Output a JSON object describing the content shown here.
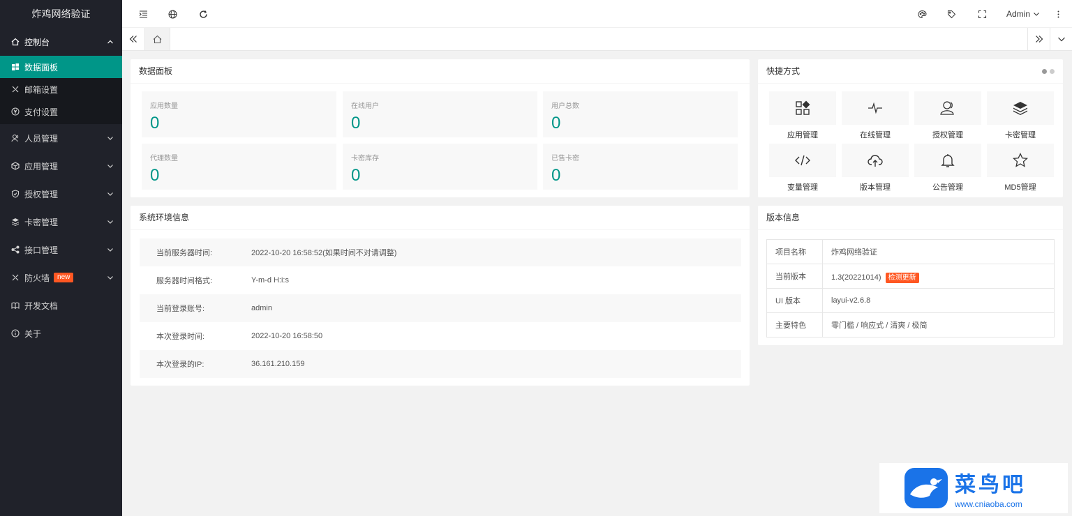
{
  "app": {
    "title": "炸鸡网络验证"
  },
  "sidebar": {
    "console": {
      "label": "控制台"
    },
    "console_items": [
      {
        "label": "数据面板",
        "icon": "grid-icon",
        "active": true
      },
      {
        "label": "邮箱设置",
        "icon": "tool-icon"
      },
      {
        "label": "支付设置",
        "icon": "yen-icon"
      }
    ],
    "items": [
      {
        "label": "人员管理",
        "icon": "users-icon"
      },
      {
        "label": "应用管理",
        "icon": "cube-icon"
      },
      {
        "label": "授权管理",
        "icon": "shield-icon"
      },
      {
        "label": "卡密管理",
        "icon": "layers-icon"
      },
      {
        "label": "接口管理",
        "icon": "share-icon"
      },
      {
        "label": "防火墙",
        "icon": "tool-icon",
        "badge": "new"
      },
      {
        "label": "开发文档",
        "icon": "docs-icon"
      },
      {
        "label": "关于",
        "icon": "info-icon"
      }
    ]
  },
  "header": {
    "user": "Admin"
  },
  "stats": {
    "title": "数据面板",
    "items": [
      {
        "label": "应用数量",
        "value": "0"
      },
      {
        "label": "在线用户",
        "value": "0"
      },
      {
        "label": "用户总数",
        "value": "0"
      },
      {
        "label": "代理数量",
        "value": "0"
      },
      {
        "label": "卡密库存",
        "value": "0"
      },
      {
        "label": "已售卡密",
        "value": "0"
      }
    ]
  },
  "shortcuts": {
    "title": "快捷方式",
    "items": [
      {
        "label": "应用管理",
        "icon": "apps-icon"
      },
      {
        "label": "在线管理",
        "icon": "pulse-icon"
      },
      {
        "label": "授权管理",
        "icon": "user-icon"
      },
      {
        "label": "卡密管理",
        "icon": "layers-icon"
      },
      {
        "label": "变量管理",
        "icon": "code-icon"
      },
      {
        "label": "版本管理",
        "icon": "cloud-upload-icon"
      },
      {
        "label": "公告管理",
        "icon": "bell-icon"
      },
      {
        "label": "MD5管理",
        "icon": "star-icon"
      }
    ]
  },
  "system": {
    "title": "系统环境信息",
    "rows": [
      {
        "key": "当前服务器时间:",
        "value": "2022-10-20 16:58:52(如果时间不对请调整)"
      },
      {
        "key": "服务器时间格式:",
        "value": "Y-m-d H:i:s"
      },
      {
        "key": "当前登录账号:",
        "value": "admin"
      },
      {
        "key": "本次登录时间:",
        "value": "2022-10-20 16:58:50"
      },
      {
        "key": "本次登录的IP:",
        "value": "36.161.210.159"
      }
    ]
  },
  "version": {
    "title": "版本信息",
    "rows": [
      {
        "key": "项目名称",
        "value": "炸鸡网络验证"
      },
      {
        "key": "当前版本",
        "value": "1.3(20221014)",
        "tag": "检测更新"
      },
      {
        "key": "UI 版本",
        "value": "layui-v2.6.8"
      },
      {
        "key": "主要特色",
        "value": "零门槛 / 响应式 / 清爽 / 极简"
      }
    ]
  },
  "watermark": {
    "title": "菜鸟吧",
    "url": "www.cniaoba.com"
  },
  "colors": {
    "accent": "#009688",
    "sidebar_bg": "#20222a",
    "badge": "#ff5722"
  }
}
